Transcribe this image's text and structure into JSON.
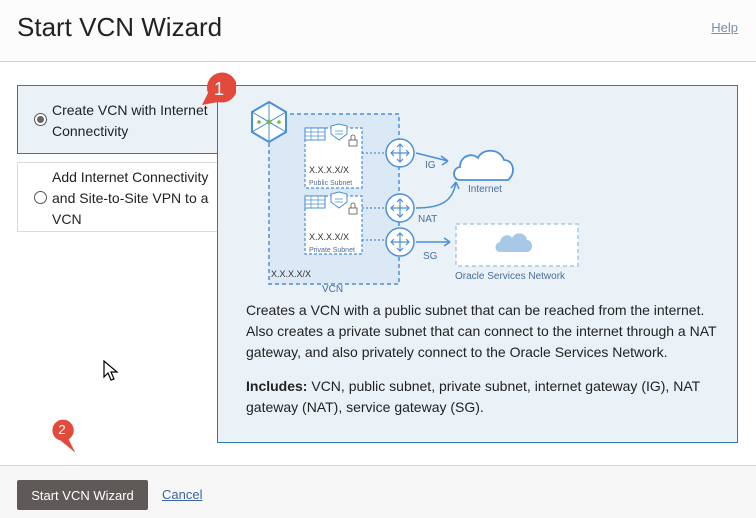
{
  "header": {
    "title": "Start VCN Wizard",
    "help_label": "Help"
  },
  "options": [
    {
      "label": "Create VCN with Internet Connectivity",
      "selected": true
    },
    {
      "label": "Add Internet Connectivity and Site-to-Site VPN to a VCN",
      "selected": false
    }
  ],
  "diagram": {
    "public_subnet_cidr": "X.X.X.X/X",
    "public_subnet_label": "Public Subnet",
    "private_subnet_cidr": "X.X.X.X/X",
    "private_subnet_label": "Private Subnet",
    "vcn_cidr": "X.X.X.X/X",
    "vcn_label": "VCN",
    "ig_label": "IG",
    "nat_label": "NAT",
    "sg_label": "SG",
    "internet_label": "Internet",
    "osn_label": "Oracle Services Network"
  },
  "description": "Creates a VCN with a public subnet that can be reached from the internet. Also creates a private subnet that can connect to the internet through a NAT gateway, and also privately connect to the Oracle Services Network.",
  "includes": {
    "label": "Includes:",
    "text": " VCN, public subnet, private subnet, internet gateway (IG), NAT gateway (NAT), service gateway (SG)."
  },
  "footer": {
    "start_label": "Start VCN Wizard",
    "cancel_label": "Cancel"
  },
  "callouts": {
    "one": "1",
    "two": "2"
  },
  "colors": {
    "accent": "#2a7ea6",
    "callout": "#e24a3b",
    "button": "#5f5a57",
    "panel_bg": "#eaf2f7",
    "diagram_blue": "#4a90d9"
  }
}
